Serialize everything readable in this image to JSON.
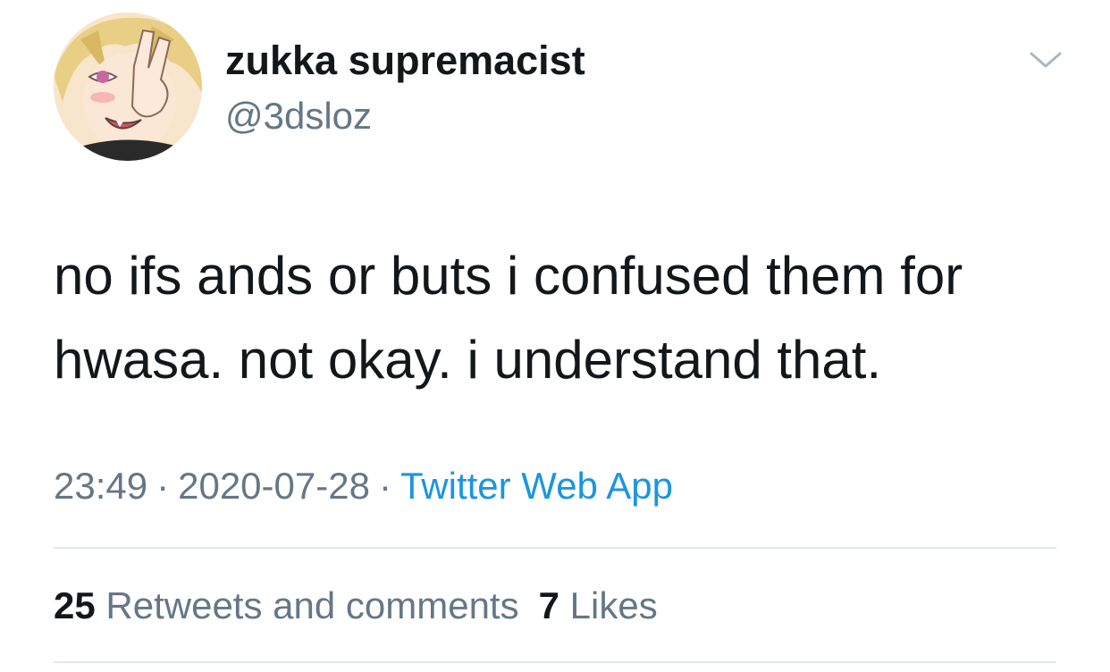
{
  "user": {
    "display_name": "zukka supremacist",
    "handle": "@3dsloz",
    "avatar_icon": "anime-avatar"
  },
  "tweet": {
    "text_line1": "no ifs ands or buts i confused them for",
    "text_line2": "hwasa. not okay. i understand that.",
    "time": "23:49",
    "date": "2020-07-28",
    "separator": "·",
    "source": "Twitter Web App"
  },
  "stats": {
    "retweets_count": "25",
    "retweets_label": "Retweets and comments",
    "likes_count": "7",
    "likes_label": "Likes"
  },
  "colors": {
    "text": "#14171a",
    "secondary": "#657786",
    "link": "#1b95e0",
    "divider": "#e1e8ed"
  }
}
